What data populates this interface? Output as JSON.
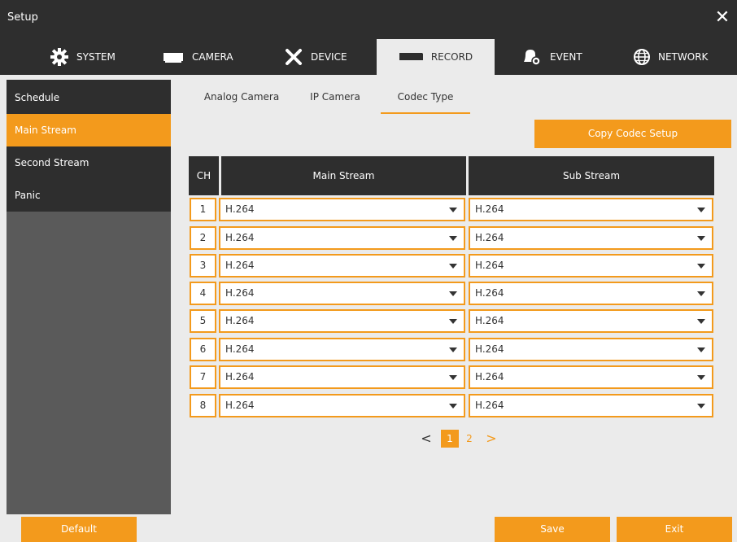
{
  "window": {
    "title": "Setup"
  },
  "topnav": {
    "tabs": [
      {
        "label": "SYSTEM",
        "icon": "gear-icon"
      },
      {
        "label": "CAMERA",
        "icon": "camera-icon"
      },
      {
        "label": "DEVICE",
        "icon": "tools-icon"
      },
      {
        "label": "RECORD",
        "icon": "recorder-icon",
        "active": true
      },
      {
        "label": "EVENT",
        "icon": "bell-icon"
      },
      {
        "label": "NETWORK",
        "icon": "globe-icon"
      }
    ]
  },
  "sidebar": {
    "items": [
      {
        "label": "Schedule"
      },
      {
        "label": "Main Stream",
        "active": true
      },
      {
        "label": "Second Stream"
      },
      {
        "label": "Panic"
      }
    ]
  },
  "subtabs": [
    {
      "label": "Analog Camera"
    },
    {
      "label": "IP Camera"
    },
    {
      "label": "Codec Type",
      "active": true
    }
  ],
  "copy_button": "Copy Codec Setup",
  "table": {
    "headers": {
      "ch": "CH",
      "main": "Main Stream",
      "sub": "Sub Stream"
    },
    "rows": [
      {
        "ch": "1",
        "main": "H.264",
        "sub": "H.264"
      },
      {
        "ch": "2",
        "main": "H.264",
        "sub": "H.264"
      },
      {
        "ch": "3",
        "main": "H.264",
        "sub": "H.264"
      },
      {
        "ch": "4",
        "main": "H.264",
        "sub": "H.264"
      },
      {
        "ch": "5",
        "main": "H.264",
        "sub": "H.264"
      },
      {
        "ch": "6",
        "main": "H.264",
        "sub": "H.264"
      },
      {
        "ch": "7",
        "main": "H.264",
        "sub": "H.264"
      },
      {
        "ch": "8",
        "main": "H.264",
        "sub": "H.264"
      }
    ]
  },
  "pager": {
    "prev": "<",
    "next": ">",
    "pages": [
      "1",
      "2"
    ],
    "current": "1"
  },
  "buttons": {
    "default": "Default",
    "save": "Save",
    "exit": "Exit"
  },
  "colors": {
    "accent": "#f39a1c",
    "dark": "#2e2e2e",
    "background": "#ebebeb",
    "sidebar_fill": "#5a5a5a"
  }
}
